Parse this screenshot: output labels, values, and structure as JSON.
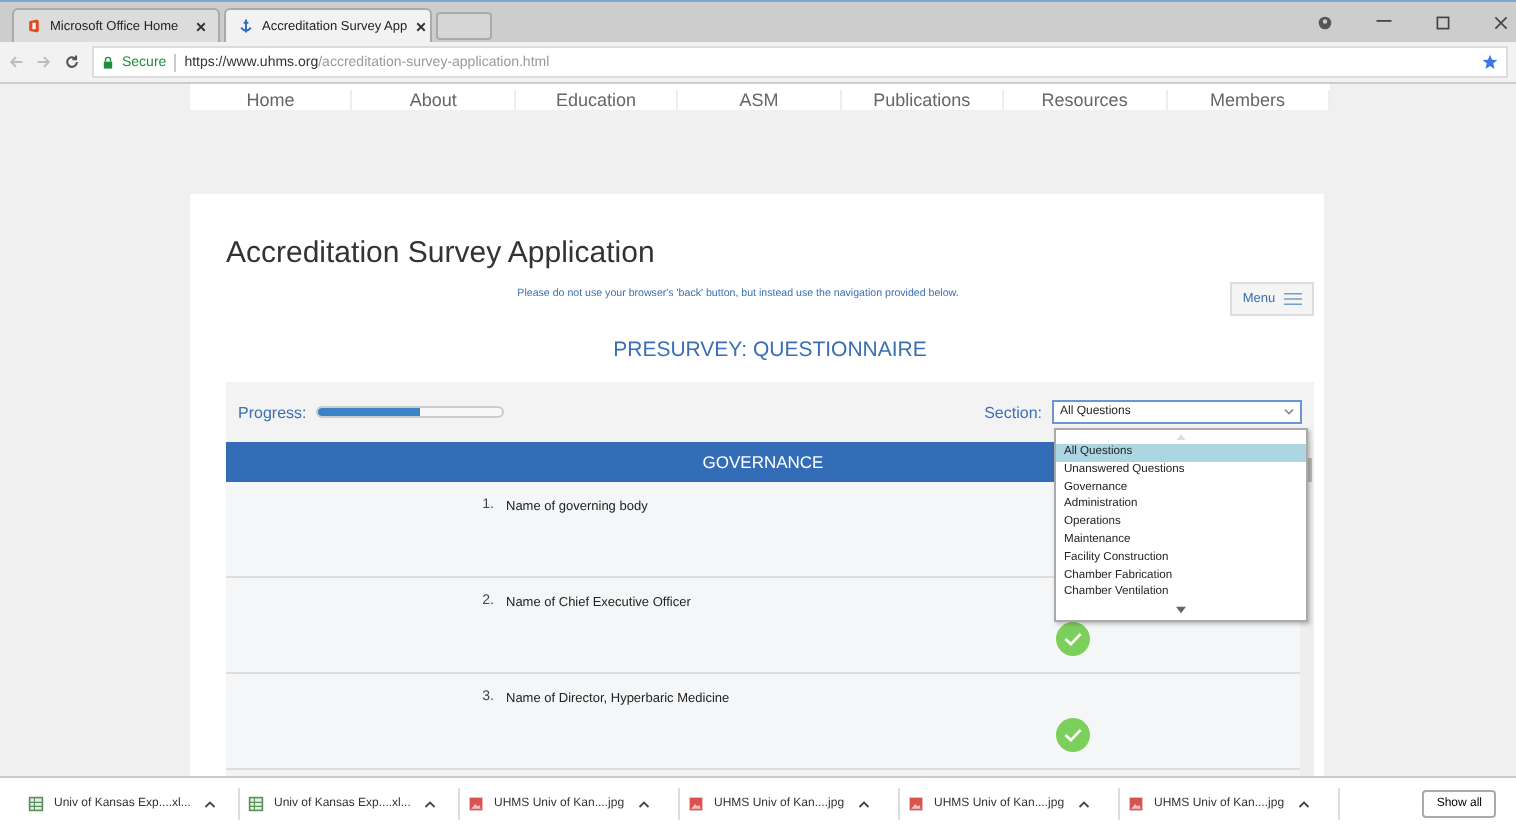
{
  "browser": {
    "tabs": [
      {
        "title": "Microsoft Office Home",
        "kind": "office",
        "selected": false
      },
      {
        "title": "Accreditation Survey App",
        "kind": "anchor",
        "selected": true
      }
    ],
    "secure_label": "Secure",
    "url_host": "https://www.uhms.org",
    "url_path": "/accreditation-survey-application.html"
  },
  "nav": [
    "Home",
    "About",
    "Education",
    "ASM",
    "Publications",
    "Resources",
    "Members"
  ],
  "page": {
    "title": "Accreditation Survey Application",
    "notice": "Please do not use your browser's 'back' button, but instead use the navigation provided below.",
    "menu_label": "Menu",
    "heading": "PRESURVEY: QUESTIONNAIRE"
  },
  "progress": {
    "label": "Progress:",
    "level": 0.55
  },
  "section": {
    "label": "Section:",
    "value": "All Questions",
    "options": [
      {
        "label": "All Questions",
        "selected": true
      },
      {
        "label": "Unanswered Questions",
        "selected": false
      },
      {
        "label": "Governance",
        "selected": false
      },
      {
        "label": "Administration",
        "selected": false
      },
      {
        "label": "Operations",
        "selected": false
      },
      {
        "label": "Maintenance",
        "selected": false
      },
      {
        "label": "Facility Construction",
        "selected": false
      },
      {
        "label": "Chamber Fabrication",
        "selected": false
      },
      {
        "label": "Chamber Ventilation",
        "selected": false
      }
    ]
  },
  "group_header": "GOVERNANCE",
  "questions": [
    {
      "number": "1.",
      "text": "Name of governing body"
    },
    {
      "number": "2.",
      "text": "Name of Chief Executive Officer",
      "answered": true
    },
    {
      "number": "3.",
      "text": "Name of Director, Hyperbaric Medicine",
      "answered": true
    }
  ],
  "downloads": [
    {
      "name": "Univ of Kansas Exp....xl...",
      "kind": "sheet"
    },
    {
      "name": "Univ of Kansas Exp....xl...",
      "kind": "sheet"
    },
    {
      "name": "UHMS Univ of Kan....jpg",
      "kind": "image"
    },
    {
      "name": "UHMS Univ of Kan....jpg",
      "kind": "image"
    },
    {
      "name": "UHMS Univ of Kan....jpg",
      "kind": "image"
    },
    {
      "name": "UHMS Univ of Kan....jpg",
      "kind": "image"
    }
  ],
  "show_all": "Show all"
}
